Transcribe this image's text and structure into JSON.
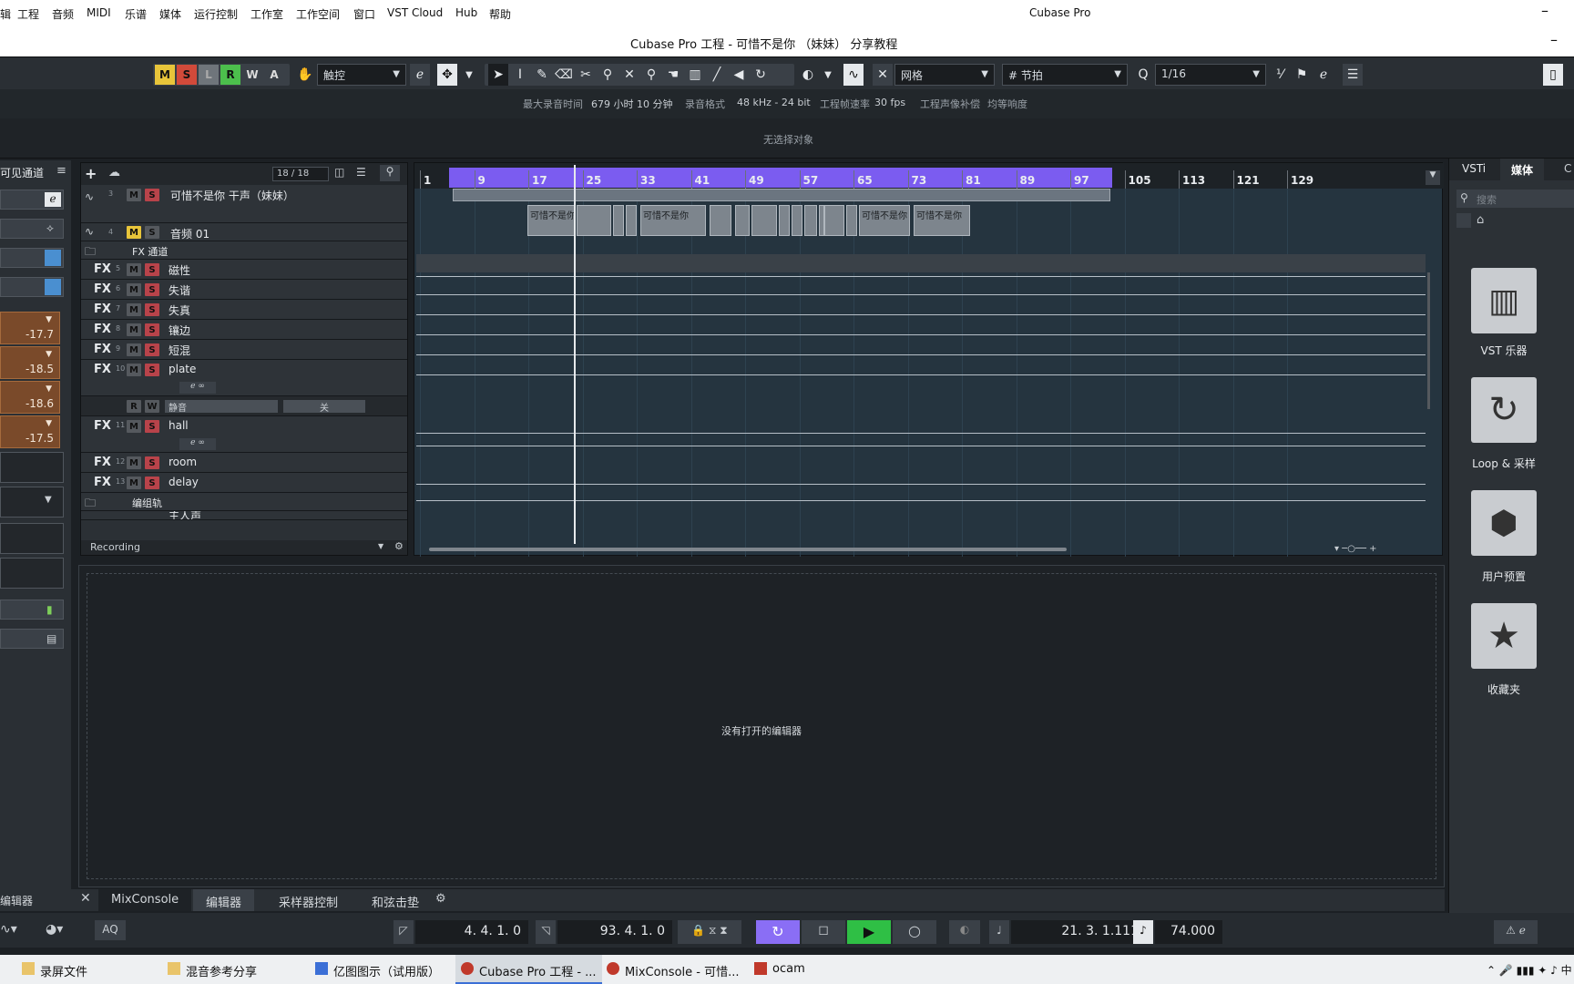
{
  "menu": [
    "辑",
    "工程",
    "音频",
    "MIDI",
    "乐谱",
    "媒体",
    "运行控制",
    "工作室",
    "工作空间",
    "窗口",
    "VST Cloud",
    "Hub",
    "帮助"
  ],
  "app_name": "Cubase Pro",
  "window_title": "Cubase Pro 工程 - 可惜不是你 （妹妹） 分享教程",
  "toolbar": {
    "mode_buttons": [
      "M",
      "S",
      "L",
      "R",
      "W",
      "A"
    ],
    "automation_mode": "触控",
    "snap_type": "网格",
    "grid_type": "节拍",
    "quantize": "1/16"
  },
  "info": {
    "max_record_label": "最大录音时间",
    "max_record_value": "679 小时 10 分钟",
    "format_label": "录音格式",
    "format_value": "48 kHz - 24 bit",
    "framerate_label": "工程帧速率",
    "framerate_value": "30 fps",
    "pan_law_label": "工程声像补偿",
    "loudness_label": "均等响度"
  },
  "status": "无选择对象",
  "inspector": {
    "header": "可见通道",
    "faders": [
      "-17.7",
      "-18.5",
      "-18.6",
      "-17.5"
    ]
  },
  "tracklist": {
    "counter": "18 / 18",
    "footer": "Recording",
    "tracks": [
      {
        "num": "3",
        "name": "可惜不是你 干声（妹妹）"
      },
      {
        "num": "4",
        "name": "音频 01"
      },
      {
        "num": "",
        "name": "FX 通道"
      },
      {
        "num": "5",
        "name": "磁性"
      },
      {
        "num": "6",
        "name": "失谐"
      },
      {
        "num": "7",
        "name": "失真"
      },
      {
        "num": "8",
        "name": "镶边"
      },
      {
        "num": "9",
        "name": "短混"
      },
      {
        "num": "10",
        "name": "plate"
      },
      {
        "num": "",
        "name": "静音"
      },
      {
        "num": "",
        "name": "关"
      },
      {
        "num": "11",
        "name": "hall"
      },
      {
        "num": "12",
        "name": "room"
      },
      {
        "num": "13",
        "name": "delay"
      },
      {
        "num": "",
        "name": "编组轨"
      },
      {
        "num": "",
        "name": "主人声"
      }
    ]
  },
  "ruler": [
    "1",
    "9",
    "17",
    "25",
    "33",
    "41",
    "49",
    "57",
    "65",
    "73",
    "81",
    "89",
    "97",
    "105",
    "113",
    "121",
    "129"
  ],
  "clip_label": "可惜不是你",
  "editor_empty": "没有打开的编辑器",
  "bottom_tabs": [
    "编辑器",
    "MixConsole",
    "编辑器",
    "采样器控制",
    "和弦击垫"
  ],
  "transport": {
    "aq": "AQ",
    "left_locator": "4. 4. 1.   0",
    "right_locator": "93. 4. 1.   0",
    "position": "21. 3. 1.111",
    "tempo": "74.000"
  },
  "rightpanel": {
    "tabs": [
      "VSTi",
      "媒体",
      "C"
    ],
    "search_placeholder": "搜索",
    "tiles": [
      "VST 乐器",
      "Loop & 采样",
      "用户预置",
      "收藏夹"
    ]
  },
  "taskbar": [
    "录屏文件",
    "混音参考分享",
    "亿图图示（试用版）",
    "Cubase Pro 工程 - ...",
    "MixConsole - 可惜...",
    "ocam"
  ],
  "colors": {
    "cycle": "#7b5cf0",
    "play": "#2fbf45",
    "solo": "#b8434a",
    "record": "#e74c3c"
  }
}
